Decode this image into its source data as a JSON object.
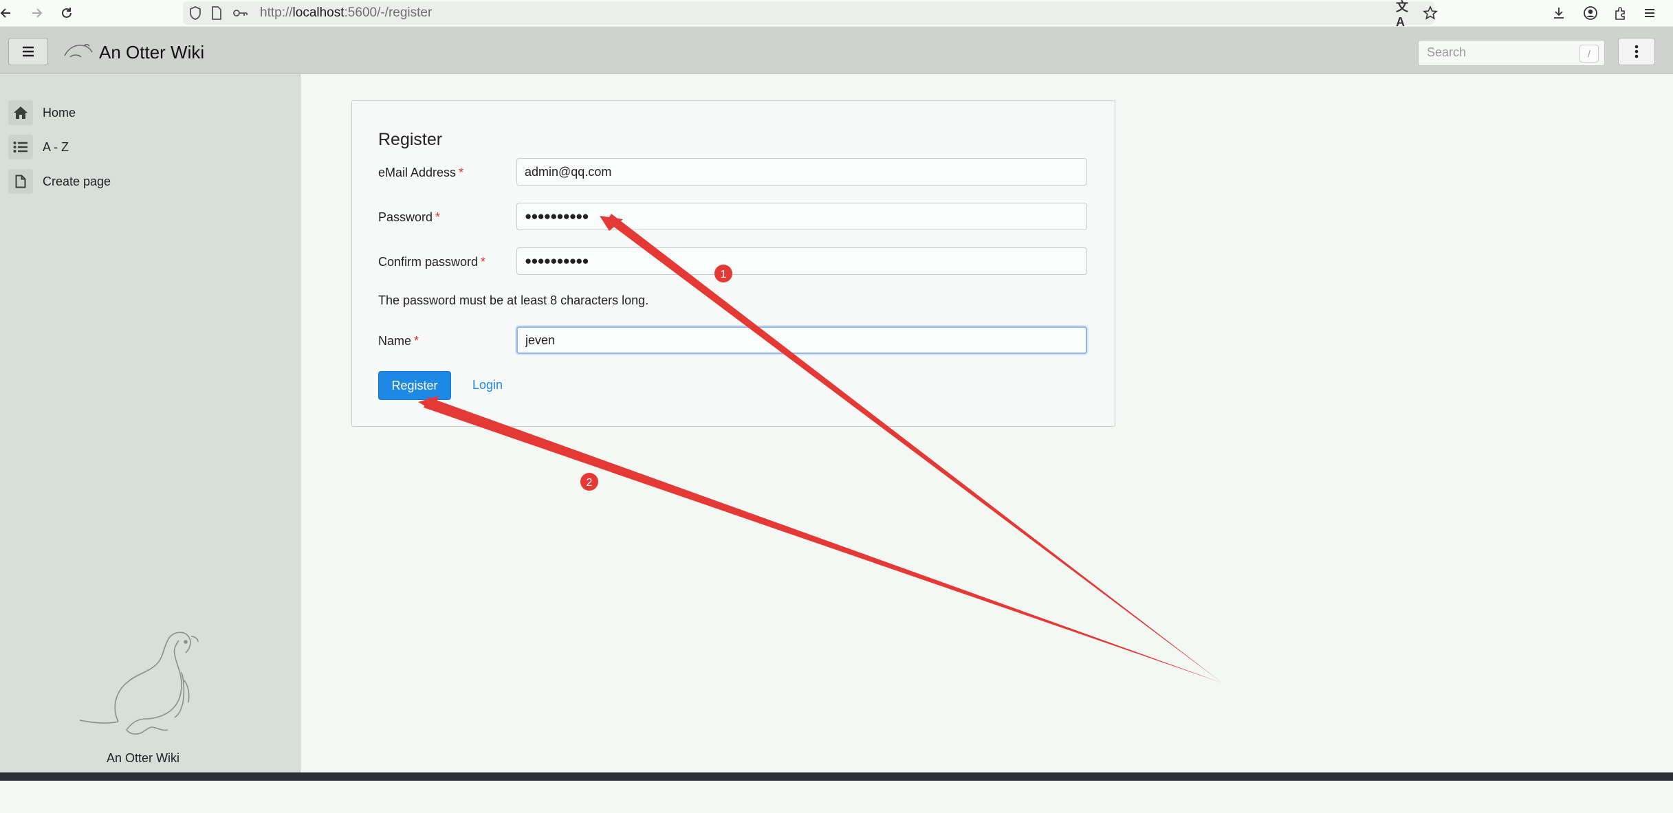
{
  "browser": {
    "url_prefix": "http://",
    "url_host": "localhost",
    "url_path": ":5600/-/register"
  },
  "header": {
    "app_title": "An Otter Wiki",
    "search_placeholder": "Search",
    "search_shortcut": "/"
  },
  "sidebar": {
    "items": [
      {
        "label": "Home",
        "icon": "home-icon"
      },
      {
        "label": "A - Z",
        "icon": "list-icon"
      },
      {
        "label": "Create page",
        "icon": "file-icon"
      }
    ],
    "footer_label": "An Otter Wiki"
  },
  "register": {
    "title": "Register",
    "email_label": "eMail Address",
    "email_value": "admin@qq.com",
    "password_label": "Password",
    "password_value": "●●●●●●●●●●",
    "confirm_label": "Confirm password",
    "confirm_value": "●●●●●●●●●●",
    "required_mark": "*",
    "hint": "The password must be at least 8 characters long.",
    "name_label": "Name",
    "name_value": "jeven",
    "register_button": "Register",
    "login_link": "Login"
  },
  "annotations": {
    "badge_1": "1",
    "badge_2": "2",
    "color": "#e53935"
  }
}
